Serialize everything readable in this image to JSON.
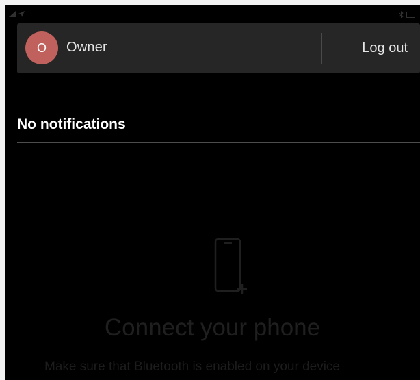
{
  "user_bar": {
    "avatar_initial": "O",
    "user_name": "Owner",
    "logout_label": "Log out"
  },
  "notifications": {
    "title": "No notifications"
  },
  "empty_state": {
    "icon": "phone-add-icon",
    "title": "Connect your phone",
    "subtitle": "Make sure that Bluetooth is enabled on your device"
  },
  "colors": {
    "background": "#000000",
    "user_bar_background": "#262626",
    "avatar": "#c1615d",
    "text_primary": "#ffffff",
    "text_dimmed": "#1f1f1f"
  }
}
